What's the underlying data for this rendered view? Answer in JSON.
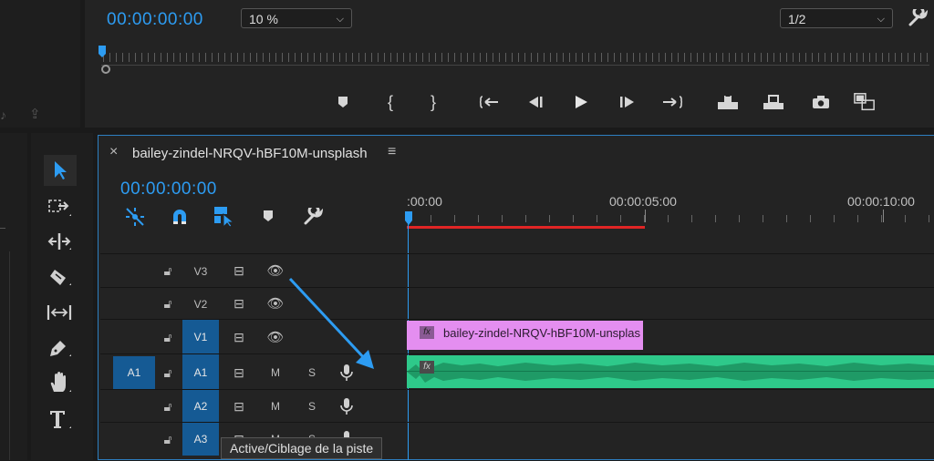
{
  "program_monitor": {
    "timecode": "00:00:00:00",
    "zoom": "10 %",
    "resolution": "1/2",
    "controls": [
      {
        "name": "add-marker-button",
        "glyph": "⬥"
      },
      {
        "name": "mark-in-button",
        "glyph": "{"
      },
      {
        "name": "mark-out-button",
        "glyph": "}"
      },
      {
        "name": "go-to-in-button",
        "glyph": "{←"
      },
      {
        "name": "step-back-button",
        "glyph": "◀|"
      },
      {
        "name": "play-button",
        "glyph": "▶"
      },
      {
        "name": "step-forward-button",
        "glyph": "|▶"
      },
      {
        "name": "go-to-out-button",
        "glyph": "→}"
      },
      {
        "name": "lift-button",
        "glyph": "⏏"
      },
      {
        "name": "extract-button",
        "glyph": "⏏"
      },
      {
        "name": "export-frame-button",
        "glyph": "📷"
      },
      {
        "name": "compare-view-button",
        "glyph": "▣"
      }
    ]
  },
  "tools": [
    "selection-tool",
    "track-select-tool",
    "ripple-edit-tool",
    "razor-tool",
    "slip-tool",
    "pen-tool",
    "hand-tool",
    "type-tool"
  ],
  "timeline": {
    "sequence_name": "bailey-zindel-NRQV-hBF10M-unsplash",
    "close_glyph": "×",
    "menu_glyph": "≡",
    "timecode": "00:00:00:00",
    "ruler": [
      ":00:00",
      "00:00:05:00",
      "00:00:10:00"
    ],
    "tracks": [
      {
        "name": "V3",
        "kind": "video"
      },
      {
        "name": "V2",
        "kind": "video"
      },
      {
        "name": "V1",
        "kind": "video",
        "targeted": true
      },
      {
        "name": "A1",
        "kind": "audio",
        "targeted": true,
        "source": "A1"
      },
      {
        "name": "A2",
        "kind": "audio",
        "targeted": true
      },
      {
        "name": "A3",
        "kind": "audio",
        "targeted": true
      }
    ],
    "mute_label": "M",
    "solo_label": "S",
    "video_clip": {
      "label": "bailey-zindel-NRQV-hBF10M-unsplas",
      "fx": "fx",
      "color": "#e48ef0"
    },
    "audio_clip": {
      "fx": "fx",
      "color": "#2ec98a"
    },
    "tooltip": "Active/Ciblage de la piste"
  },
  "colors": {
    "accent": "#2d9cf2",
    "work_area": "#e02525",
    "target": "#155a94"
  }
}
